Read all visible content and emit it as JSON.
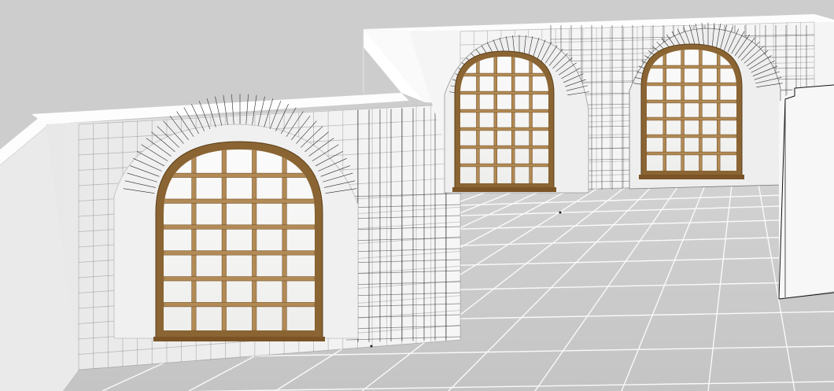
{
  "viewport": {
    "view": "perspective",
    "shading": "shaded-with-wireframe-overlay",
    "background_color": "#c9c9c9",
    "colors": {
      "floor": "#c6c6c6",
      "floor_grid": "#ffffff",
      "wall_face": "#f4f4f4",
      "wall_face_dark": "#e9e9e9",
      "wall_top": "#fdfdfd",
      "wireframe": "#1e1e1e",
      "window_frame": "#8a6432",
      "window_frame_light": "#b28a55",
      "glass": "#f5f5f3"
    }
  },
  "scene": {
    "objects": [
      {
        "name": "floor-plane",
        "type": "plane"
      },
      {
        "name": "wall-left-section",
        "type": "wall-mesh"
      },
      {
        "name": "wall-right-section",
        "type": "wall-mesh"
      },
      {
        "name": "arched-window-front",
        "type": "arched-window",
        "grid": "5x6"
      },
      {
        "name": "arched-window-middle",
        "type": "arched-window",
        "grid": "5x6"
      },
      {
        "name": "arched-window-back",
        "type": "arched-window",
        "grid": "5x6"
      },
      {
        "name": "door-frame-right",
        "type": "door-frame"
      }
    ]
  }
}
